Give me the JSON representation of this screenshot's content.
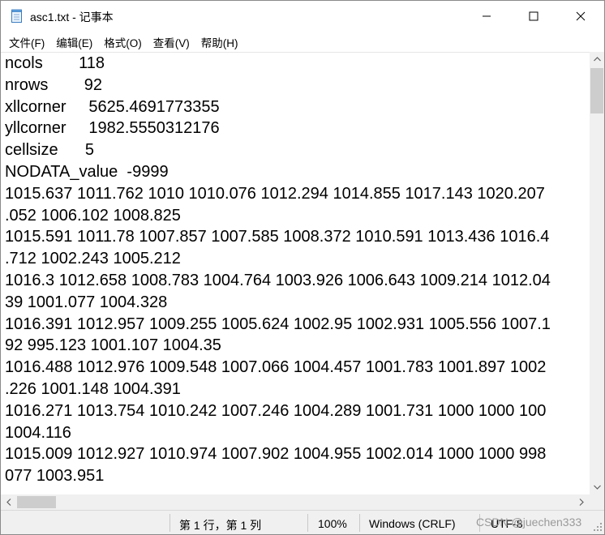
{
  "window": {
    "title": "asc1.txt - 记事本",
    "icon": "notepad-icon"
  },
  "menu": [
    {
      "label": "文件(F)"
    },
    {
      "label": "编辑(E)"
    },
    {
      "label": "格式(O)"
    },
    {
      "label": "查看(V)"
    },
    {
      "label": "帮助(H)"
    }
  ],
  "editor": {
    "lines": [
      "ncols        118",
      "nrows        92",
      "xllcorner     5625.4691773355",
      "yllcorner     1982.5550312176",
      "cellsize      5",
      "NODATA_value  -9999",
      "1015.637 1011.762 1010 1010.076 1012.294 1014.855 1017.143 1020.207",
      ".052 1006.102 1008.825",
      "1015.591 1011.78 1007.857 1007.585 1008.372 1010.591 1013.436 1016.4",
      ".712 1002.243 1005.212",
      "1016.3 1012.658 1008.783 1004.764 1003.926 1006.643 1009.214 1012.04",
      "39 1001.077 1004.328",
      "1016.391 1012.957 1009.255 1005.624 1002.95 1002.931 1005.556 1007.1",
      "92 995.123 1001.107 1004.35",
      "1016.488 1012.976 1009.548 1007.066 1004.457 1001.783 1001.897 1002",
      ".226 1001.148 1004.391",
      "1016.271 1013.754 1010.242 1007.246 1004.289 1001.731 1000 1000 100",
      "1004.116",
      "1015.009 1012.927 1010.974 1007.902 1004.955 1002.014 1000 1000 998",
      "077 1003.951"
    ]
  },
  "status": {
    "position": "第 1 行，第 1 列",
    "zoom": "100%",
    "line_ending": "Windows (CRLF)",
    "encoding": "UTF-8",
    "watermark": "CSDN @juechen333"
  }
}
